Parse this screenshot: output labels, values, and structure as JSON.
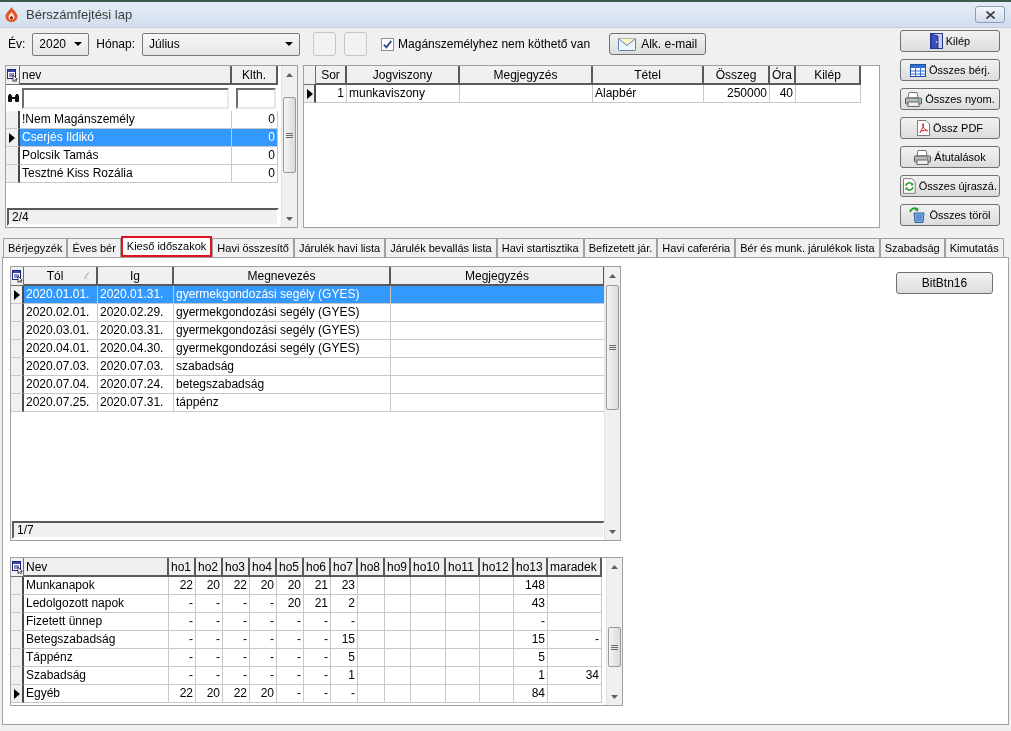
{
  "window": {
    "title": "Bérszámfejtési lap"
  },
  "toolbar": {
    "year_label": "Év:",
    "year": "2020",
    "month_label": "Hónap:",
    "month": "Július",
    "checkbox": {
      "label": "Magánszemélyhez nem köthető van",
      "checked": true
    },
    "email_button": "Alk. e-mail"
  },
  "person_grid": {
    "columns": [
      {
        "label": "nev",
        "kind": "text"
      },
      {
        "label": "Klth.",
        "kind": "number"
      }
    ],
    "rows": [
      {
        "cells": [
          "!Nem Magánszemély",
          "0"
        ],
        "selected": false,
        "current": false
      },
      {
        "cells": [
          "Cserjés Ildikó",
          "0"
        ],
        "selected": true,
        "current": true
      },
      {
        "cells": [
          "Polcsik Tamás",
          "0"
        ],
        "selected": false,
        "current": false
      },
      {
        "cells": [
          "Tesztné Kiss Rozália",
          "0"
        ],
        "selected": false,
        "current": false
      }
    ],
    "status": "2/4"
  },
  "item_grid": {
    "columns": [
      {
        "label": "Sor",
        "kind": "number"
      },
      {
        "label": "Jogviszony",
        "kind": "text"
      },
      {
        "label": "Megjegyzés",
        "kind": "text"
      },
      {
        "label": "Tétel",
        "kind": "text"
      },
      {
        "label": "Összeg",
        "kind": "number"
      },
      {
        "label": "Óra",
        "kind": "number"
      },
      {
        "label": "Kilép",
        "kind": "text"
      }
    ],
    "rows": [
      {
        "cells": [
          "1",
          "munkaviszony",
          null,
          "Alapbér",
          "250000",
          "40",
          null
        ],
        "selected": false,
        "current": true
      }
    ]
  },
  "side_buttons": [
    "Kilép",
    "Összes bérj.",
    "Összes nyom.",
    "Össz PDF",
    "Átutalások",
    "Összes újraszá.",
    "Összes töröl"
  ],
  "tabs": [
    {
      "label": "Bérjegyzék",
      "selected": false
    },
    {
      "label": "Éves bér",
      "selected": false
    },
    {
      "label": "Kieső időszakok",
      "selected": true
    },
    {
      "label": "Havi összesítő",
      "selected": false
    },
    {
      "label": "Járulék havi lista",
      "selected": false
    },
    {
      "label": "Járulék bevallás lista",
      "selected": false
    },
    {
      "label": "Havi startisztika",
      "selected": false
    },
    {
      "label": "Befizetett jár.",
      "selected": false
    },
    {
      "label": "Havi caferéria",
      "selected": false
    },
    {
      "label": "Bér és munk. járulékok lista",
      "selected": false
    },
    {
      "label": "Szabadság",
      "selected": false
    },
    {
      "label": "Kimutatás",
      "selected": false
    }
  ],
  "absence_grid": {
    "columns": [
      {
        "label": "Tól",
        "kind": "text",
        "sorted": true
      },
      {
        "label": "Ig",
        "kind": "text",
        "sorted": false
      },
      {
        "label": "Megnevezés",
        "kind": "text",
        "sorted": false
      },
      {
        "label": "Megjegyzés",
        "kind": "text",
        "sorted": false
      }
    ],
    "rows": [
      {
        "cells": [
          "2020.01.01.",
          "2020.01.31.",
          "gyermekgondozási segély (GYES)",
          null
        ],
        "selected": true,
        "current": true
      },
      {
        "cells": [
          "2020.02.01.",
          "2020.02.29.",
          "gyermekgondozási segély (GYES)",
          null
        ],
        "selected": false,
        "current": false
      },
      {
        "cells": [
          "2020.03.01.",
          "2020.03.31.",
          "gyermekgondozási segély (GYES)",
          null
        ],
        "selected": false,
        "current": false
      },
      {
        "cells": [
          "2020.04.01.",
          "2020.04.30.",
          "gyermekgondozási segély (GYES)",
          null
        ],
        "selected": false,
        "current": false
      },
      {
        "cells": [
          "2020.07.03.",
          "2020.07.03.",
          "szabadság",
          null
        ],
        "selected": false,
        "current": false
      },
      {
        "cells": [
          "2020.07.04.",
          "2020.07.24.",
          "betegszabadság",
          null
        ],
        "selected": false,
        "current": false
      },
      {
        "cells": [
          "2020.07.25.",
          "2020.07.31.",
          "táppénz",
          null
        ],
        "selected": false,
        "current": false
      }
    ],
    "status": "1/7"
  },
  "panel_button": "BitBtn16",
  "summary_grid": {
    "columns": [
      {
        "label": "Nev",
        "kind": "text"
      },
      {
        "label": "ho1",
        "kind": "number"
      },
      {
        "label": "ho2",
        "kind": "number"
      },
      {
        "label": "ho3",
        "kind": "number"
      },
      {
        "label": "ho4",
        "kind": "number"
      },
      {
        "label": "ho5",
        "kind": "number"
      },
      {
        "label": "ho6",
        "kind": "number"
      },
      {
        "label": "ho7",
        "kind": "number"
      },
      {
        "label": "ho8",
        "kind": "number"
      },
      {
        "label": "ho9",
        "kind": "number"
      },
      {
        "label": "ho10",
        "kind": "number"
      },
      {
        "label": "ho11",
        "kind": "number"
      },
      {
        "label": "ho12",
        "kind": "number"
      },
      {
        "label": "ho13",
        "kind": "number"
      },
      {
        "label": "maradek",
        "kind": "number"
      }
    ],
    "rows": [
      {
        "cells": [
          "Munkanapok",
          "22",
          "20",
          "22",
          "20",
          "20",
          "21",
          "23",
          null,
          null,
          null,
          null,
          null,
          "148",
          null
        ],
        "selected": false,
        "current": false
      },
      {
        "cells": [
          "Ledolgozott napok",
          "-",
          "-",
          "-",
          "-",
          "20",
          "21",
          "2",
          null,
          null,
          null,
          null,
          null,
          "43",
          null
        ],
        "selected": false,
        "current": false
      },
      {
        "cells": [
          "Fizetett ünnep",
          "-",
          "-",
          "-",
          "-",
          "-",
          "-",
          "-",
          null,
          null,
          null,
          null,
          null,
          "-",
          null
        ],
        "selected": false,
        "current": false
      },
      {
        "cells": [
          "Betegszabadság",
          "-",
          "-",
          "-",
          "-",
          "-",
          "-",
          "15",
          null,
          null,
          null,
          null,
          null,
          "15",
          "-"
        ],
        "selected": false,
        "current": false
      },
      {
        "cells": [
          "Táppénz",
          "-",
          "-",
          "-",
          "-",
          "-",
          "-",
          "5",
          null,
          null,
          null,
          null,
          null,
          "5",
          null
        ],
        "selected": false,
        "current": false
      },
      {
        "cells": [
          "Szabadság",
          "-",
          "-",
          "-",
          "-",
          "-",
          "-",
          "1",
          null,
          null,
          null,
          null,
          null,
          "1",
          "34"
        ],
        "selected": false,
        "current": false
      },
      {
        "cells": [
          "Egyéb",
          "22",
          "20",
          "22",
          "20",
          "-",
          "-",
          "-",
          null,
          null,
          null,
          null,
          null,
          "84",
          null
        ],
        "selected": false,
        "current": true
      }
    ]
  }
}
